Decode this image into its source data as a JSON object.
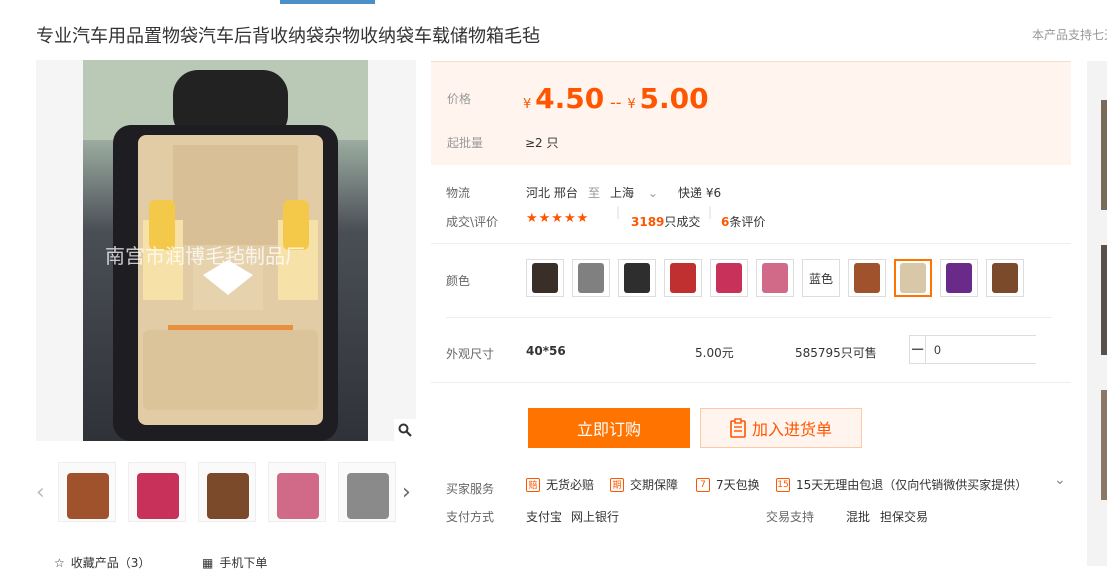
{
  "title": "专业汽车用品置物袋汽车后背收纳袋杂物收纳袋车载储物箱毛毡",
  "title_note": "本产品支持七天",
  "gallery": {
    "watermark": "南宫市润博毛毡制品厂",
    "zoom_icon": "magnifier-icon",
    "thumb_colors": [
      "#a0522d",
      "#c8325a",
      "#7a4a2a",
      "#d06a88",
      "#8a8a8a"
    ],
    "prev_icon": "chevron-left-icon",
    "next_icon": "chevron-right-icon"
  },
  "price": {
    "label": "价格",
    "currency": "¥",
    "low": "4.50",
    "separator": "--",
    "high": "5.00"
  },
  "moq": {
    "label": "起批量",
    "value": "≥2 只"
  },
  "logistics": {
    "label": "物流",
    "from": "河北 邢台",
    "to_word": "至",
    "to": "上海",
    "express": "快递 ¥6"
  },
  "deals": {
    "label": "成交\\评价",
    "stars": "★★★★★",
    "count": "3189",
    "count_suffix": "只成交",
    "reviews": "6",
    "reviews_suffix": "条评价"
  },
  "color": {
    "label": "颜色",
    "options": [
      {
        "type": "img",
        "tone": "#3a2e28"
      },
      {
        "type": "img",
        "tone": "#808080"
      },
      {
        "type": "img",
        "tone": "#2e2e2e"
      },
      {
        "type": "img",
        "tone": "#c03030"
      },
      {
        "type": "img",
        "tone": "#c8325a"
      },
      {
        "type": "img",
        "tone": "#d06a88"
      },
      {
        "type": "text",
        "text": "蓝色"
      },
      {
        "type": "img",
        "tone": "#a0522d"
      },
      {
        "type": "img",
        "tone": "#d8c8a8",
        "selected": true
      },
      {
        "type": "img",
        "tone": "#6a2a8a"
      },
      {
        "type": "img",
        "tone": "#7a4a2a"
      }
    ]
  },
  "size": {
    "label": "外观尺寸",
    "value": "40*56",
    "price": "5.00元",
    "stock": "585795只可售",
    "qty": "0"
  },
  "buttons": {
    "buy": "立即订购",
    "cart": "加入进货单"
  },
  "services": {
    "label": "买家服务",
    "items": [
      "无货必赔",
      "交期保障",
      "7天包换",
      "15天无理由包退（仅向代销微供买家提供）"
    ]
  },
  "payment": {
    "label": "支付方式",
    "methods": [
      "支付宝",
      "网上银行"
    ]
  },
  "trade": {
    "label": "交易支持",
    "methods": [
      "混批",
      "担保交易"
    ]
  },
  "bottom": {
    "favorite": "收藏产品（3）",
    "mobile": "手机下单"
  }
}
